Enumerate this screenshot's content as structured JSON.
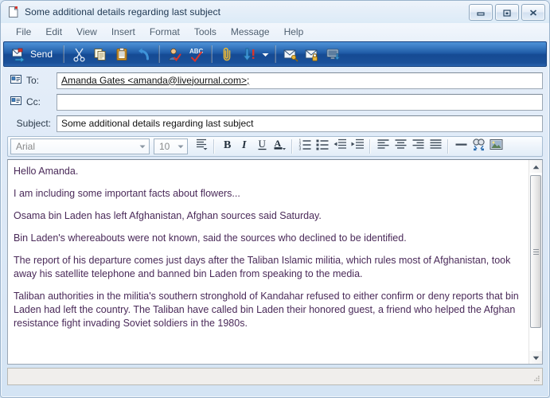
{
  "window": {
    "title": "Some additional details regarding last subject",
    "title_icon": "document-icon",
    "buttons": {
      "minimize": "minimize-button",
      "restore": "restore-button",
      "close": "close-button"
    }
  },
  "menubar": {
    "items": [
      {
        "label": "File"
      },
      {
        "label": "Edit"
      },
      {
        "label": "View"
      },
      {
        "label": "Insert"
      },
      {
        "label": "Format"
      },
      {
        "label": "Tools"
      },
      {
        "label": "Message"
      },
      {
        "label": "Help"
      }
    ]
  },
  "toolbar": {
    "send_label": "Send",
    "items": [
      {
        "name": "send-button",
        "icon": "send-icon",
        "label": "Send"
      },
      {
        "name": "cut-button",
        "icon": "scissors-icon",
        "label": "Cut"
      },
      {
        "name": "copy-button",
        "icon": "copy-icon",
        "label": "Copy"
      },
      {
        "name": "paste-button",
        "icon": "clipboard-icon",
        "label": "Paste"
      },
      {
        "name": "undo-button",
        "icon": "undo-arrow-icon",
        "label": "Undo"
      },
      {
        "name": "check-names-button",
        "icon": "person-check-icon",
        "label": "Check Names"
      },
      {
        "name": "spelling-button",
        "icon": "abc-check-icon",
        "label": "Spelling"
      },
      {
        "name": "attach-button",
        "icon": "paperclip-icon",
        "label": "Attach"
      },
      {
        "name": "priority-button",
        "icon": "priority-arrow-icon",
        "label": "Priority"
      },
      {
        "name": "priority-dropdown",
        "icon": "chevron-down-icon",
        "label": "Priority options"
      },
      {
        "name": "sign-button",
        "icon": "envelope-key-icon",
        "label": "Sign"
      },
      {
        "name": "encrypt-button",
        "icon": "envelope-lock-icon",
        "label": "Encrypt"
      },
      {
        "name": "offline-button",
        "icon": "monitor-download-icon",
        "label": "Work Offline"
      }
    ]
  },
  "headers": {
    "to": {
      "label": "To:",
      "icon": "address-card-icon",
      "value": "Amanda Gates <amanda@livejournal.com>;",
      "placeholder": ""
    },
    "cc": {
      "label": "Cc:",
      "icon": "address-card-icon",
      "value": "",
      "placeholder": ""
    },
    "subject": {
      "label": "Subject:",
      "value": "Some additional details regarding last subject",
      "placeholder": ""
    }
  },
  "format_toolbar": {
    "font": {
      "value": "Arial",
      "placeholder": "Arial"
    },
    "size": {
      "value": "10",
      "placeholder": "10"
    },
    "buttons": [
      {
        "name": "paragraph-style-button",
        "icon": "paragraph-style-icon",
        "label": "Paragraph Style"
      },
      {
        "name": "bold-button",
        "icon": "bold-icon",
        "label": "B"
      },
      {
        "name": "italic-button",
        "icon": "italic-icon",
        "label": "I"
      },
      {
        "name": "underline-button",
        "icon": "underline-icon",
        "label": "U"
      },
      {
        "name": "font-color-button",
        "icon": "font-color-icon",
        "label": "A"
      },
      {
        "name": "numbered-list-button",
        "icon": "numbered-list-icon",
        "label": "Numbers"
      },
      {
        "name": "bulleted-list-button",
        "icon": "bulleted-list-icon",
        "label": "Bullets"
      },
      {
        "name": "decrease-indent-button",
        "icon": "decrease-indent-icon",
        "label": "Decrease Indent"
      },
      {
        "name": "increase-indent-button",
        "icon": "increase-indent-icon",
        "label": "Increase Indent"
      },
      {
        "name": "align-left-button",
        "icon": "align-left-icon",
        "label": "Align Left"
      },
      {
        "name": "align-center-button",
        "icon": "align-center-icon",
        "label": "Center"
      },
      {
        "name": "align-right-button",
        "icon": "align-right-icon",
        "label": "Align Right"
      },
      {
        "name": "justify-button",
        "icon": "justify-icon",
        "label": "Justify"
      },
      {
        "name": "horizontal-line-button",
        "icon": "horizontal-line-icon",
        "label": "Horizontal Line"
      },
      {
        "name": "insert-link-button",
        "icon": "link-icon",
        "label": "Insert Hyperlink"
      },
      {
        "name": "insert-picture-button",
        "icon": "picture-icon",
        "label": "Insert Picture"
      }
    ]
  },
  "body": {
    "text_color": "#4a2a59",
    "paragraphs": [
      "Hello Amanda.",
      "I am including some important facts about flowers...",
      "Osama bin Laden has left Afghanistan, Afghan sources said Saturday.",
      "Bin Laden's whereabouts were not known, said the sources who declined to be identified.",
      "The report of his departure comes just days after the Taliban Islamic militia, which rules most of Afghanistan, took away his satellite telephone and banned bin Laden from speaking to the media.",
      "Taliban authorities in the militia's southern stronghold of Kandahar refused to either confirm or deny reports that bin Laden had left the country. The Taliban have called bin Laden their honored guest, a friend who helped the Afghan resistance fight invading Soviet soldiers in the 1980s."
    ]
  },
  "scrollbar": {
    "up_icon": "scroll-up-arrow-icon",
    "down_icon": "scroll-down-arrow-icon",
    "thumb": "scroll-thumb"
  },
  "statusbar": {
    "text": "",
    "resize_grip": "resize-grip-icon"
  },
  "colors": {
    "toolbar_blue": "#1f5ba6",
    "window_border": "#9ab3cc",
    "body_text": "#4a2a59",
    "title_text": "#1b3550"
  }
}
